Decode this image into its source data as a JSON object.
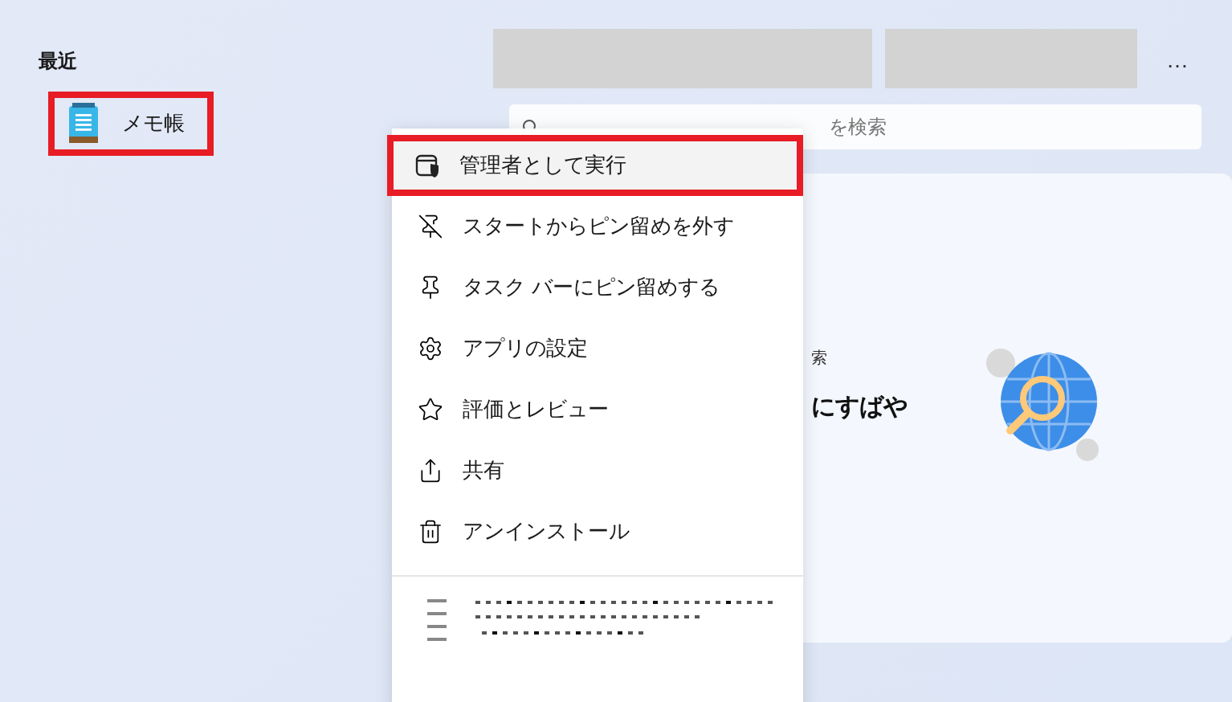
{
  "recent": {
    "heading": "最近",
    "apps": [
      {
        "name": "メモ帳",
        "highlighted": true
      }
    ]
  },
  "search": {
    "placeholder": "を検索"
  },
  "more_button": "…",
  "card": {
    "caption": "索",
    "headline": "にすばや"
  },
  "context_menu": {
    "items": [
      {
        "kind": "admin",
        "label": "管理者として実行",
        "selected": true
      },
      {
        "kind": "unpin",
        "label": "スタートからピン留めを外す",
        "selected": false
      },
      {
        "kind": "pin",
        "label": "タスク バーにピン留めする",
        "selected": false
      },
      {
        "kind": "settings",
        "label": "アプリの設定",
        "selected": false
      },
      {
        "kind": "rate",
        "label": "評価とレビュー",
        "selected": false
      },
      {
        "kind": "share",
        "label": "共有",
        "selected": false
      },
      {
        "kind": "uninstall",
        "label": "アンインストール",
        "selected": false
      }
    ]
  }
}
